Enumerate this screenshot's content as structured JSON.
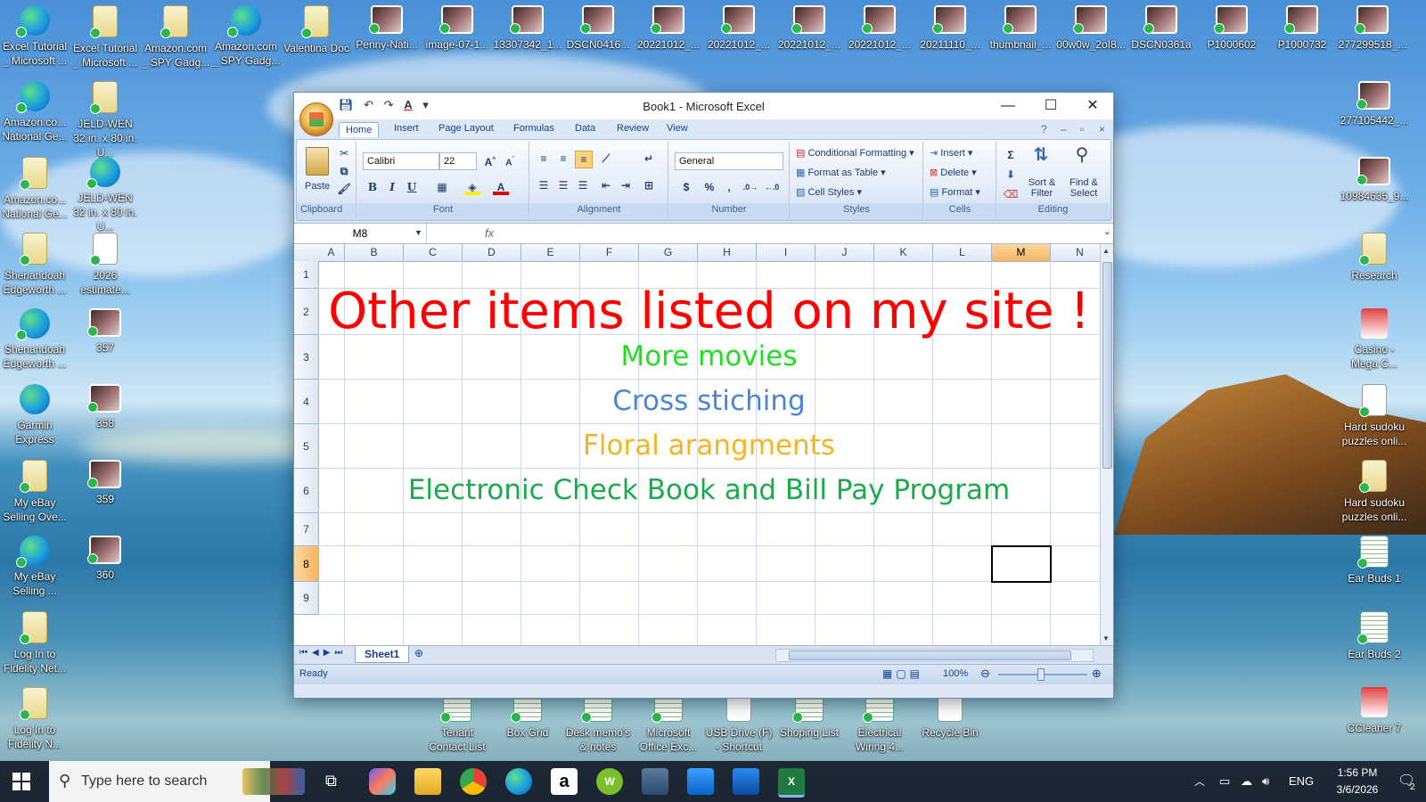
{
  "desktop": {
    "top_row": [
      {
        "label": "Excel Tutorial _ Microsoft ...",
        "icon": "edge-icon"
      },
      {
        "label": "Excel Tutorial _ Microsoft ...",
        "icon": "file-icon"
      },
      {
        "label": "Amazon.com _ SPY Gadg...",
        "icon": "file-icon"
      },
      {
        "label": "Amazon.com _ SPY Gadg...",
        "icon": "edge-icon"
      },
      {
        "label": "Valentina Doc",
        "icon": "file-icon"
      },
      {
        "label": "Penny-Nati...",
        "icon": "photo-icon"
      },
      {
        "label": "image-07-1...",
        "icon": "photo-icon"
      },
      {
        "label": "13307342_1...",
        "icon": "photo-icon"
      },
      {
        "label": "DSCN0416...",
        "icon": "photo-icon"
      },
      {
        "label": "20221012_...",
        "icon": "photo-icon"
      },
      {
        "label": "20221012_...",
        "icon": "photo-icon"
      },
      {
        "label": "20221012_...",
        "icon": "photo-icon"
      },
      {
        "label": "20221012_...",
        "icon": "photo-icon"
      },
      {
        "label": "20211110_...",
        "icon": "photo-icon"
      },
      {
        "label": "thumbnail_...",
        "icon": "photo-icon"
      },
      {
        "label": "00w0w_2oI8...",
        "icon": "photo-icon"
      },
      {
        "label": "DSCN0361a",
        "icon": "photo-icon"
      },
      {
        "label": "P1000602",
        "icon": "photo-icon"
      },
      {
        "label": "P1000732",
        "icon": "photo-icon"
      },
      {
        "label": "277299518_...",
        "icon": "photo-icon"
      }
    ],
    "left_col1": [
      {
        "label": "Amazon.co... National Ge...",
        "icon": "edge-icon"
      },
      {
        "label": "Amazon.co... National Ge...",
        "icon": "file-icon"
      },
      {
        "label": "Shenandoah Edgeworth ...",
        "icon": "file-icon"
      },
      {
        "label": "Shenandoah Edgeworth ...",
        "icon": "edge-icon"
      },
      {
        "label": "Garmin Express",
        "icon": "garmin-icon"
      },
      {
        "label": "My eBay Selling Ove...",
        "icon": "file-icon"
      },
      {
        "label": "My eBay Selling ...",
        "icon": "edge-icon"
      },
      {
        "label": "Log In to Fidelity Net...",
        "icon": "file-icon"
      },
      {
        "label": "Log In to Fidelity N...",
        "icon": "file-icon"
      }
    ],
    "left_col2": [
      {
        "label": "JELD-WEN 32 in. x 80 in. U...",
        "icon": "file-icon"
      },
      {
        "label": "JELD-WEN 32 in. x 80 in. U...",
        "icon": "edge-icon"
      },
      {
        "label": "2026 estimate...",
        "icon": "doc-icon"
      },
      {
        "label": "357",
        "icon": "photo-icon"
      },
      {
        "label": "358",
        "icon": "photo-icon"
      },
      {
        "label": "359",
        "icon": "photo-icon"
      },
      {
        "label": "360",
        "icon": "photo-icon"
      }
    ],
    "right_col": [
      {
        "label": "277105442_...",
        "icon": "photo-icon"
      },
      {
        "label": "10984635_9...",
        "icon": "photo-icon"
      },
      {
        "label": "Research",
        "icon": "file-icon"
      },
      {
        "label": "Casino - Mega C...",
        "icon": "casino-icon"
      },
      {
        "label": "Hard sudoku puzzles onli...",
        "icon": "doc-icon"
      },
      {
        "label": "Hard sudoku puzzles onli...",
        "icon": "file-icon"
      },
      {
        "label": "Ear Buds 1",
        "icon": "sheet-icon"
      },
      {
        "label": "Ear Buds 2",
        "icon": "sheet-icon"
      },
      {
        "label": "CCleaner 7",
        "icon": "ccleaner-icon"
      }
    ],
    "bottom_row": [
      {
        "label": "Tenant Contact List",
        "icon": "sheet-icon"
      },
      {
        "label": "Box Grid",
        "icon": "sheet-icon"
      },
      {
        "label": "Desk memo's & notes",
        "icon": "sheet-icon"
      },
      {
        "label": "Microsoft Office Exc...",
        "icon": "excel-icon"
      },
      {
        "label": "USB Drive (F) - Shortcut",
        "icon": "usb-icon"
      },
      {
        "label": "Shoping List",
        "icon": "sheet-icon"
      },
      {
        "label": "Electrical Wiring 4...",
        "icon": "sheet-icon"
      },
      {
        "label": "Recycle Bin",
        "icon": "recycle-bin-icon"
      }
    ]
  },
  "excel": {
    "title": "Book1 - Microsoft Excel",
    "tabs": [
      "Home",
      "Insert",
      "Page Layout",
      "Formulas",
      "Data",
      "Review",
      "View"
    ],
    "active_tab": "Home",
    "ribbon": {
      "clipboard": {
        "label": "Clipboard",
        "paste": "Paste"
      },
      "font": {
        "label": "Font",
        "name": "Calibri",
        "size": "22",
        "bold": "B",
        "italic": "I",
        "underline": "U"
      },
      "alignment": {
        "label": "Alignment"
      },
      "number": {
        "label": "Number",
        "format": "General",
        "currency": "$",
        "percent": "%",
        "comma": ","
      },
      "styles": {
        "label": "Styles",
        "conditional": "Conditional Formatting",
        "format_table": "Format as Table",
        "cell_styles": "Cell Styles"
      },
      "cells": {
        "label": "Cells",
        "insert": "Insert",
        "delete": "Delete",
        "format": "Format"
      },
      "editing": {
        "label": "Editing",
        "sort": "Sort & Filter",
        "find": "Find & Select",
        "sigma": "Σ"
      }
    },
    "name_box": "M8",
    "fx": "fx",
    "columns": [
      "A",
      "B",
      "C",
      "D",
      "E",
      "F",
      "G",
      "H",
      "I",
      "J",
      "K",
      "L",
      "M",
      "N"
    ],
    "rows": [
      "1",
      "2",
      "3",
      "4",
      "5",
      "6",
      "7",
      "8",
      "9"
    ],
    "selected_column": "M",
    "selected_row": "8",
    "cells": {
      "row2": {
        "text": "Other items listed on my site !",
        "color": "#ff0000"
      },
      "row3": {
        "text": "More movies",
        "color": "#22dd22"
      },
      "row4": {
        "text": "Cross stiching",
        "color": "#4a86d4"
      },
      "row5": {
        "text": "Floral arangments",
        "color": "#f5b423"
      },
      "row6": {
        "text": "Electronic Check Book and Bill Pay Program",
        "color": "#1aab4a"
      }
    },
    "sheet_tab": "Sheet1",
    "status": "Ready",
    "zoom": "100%"
  },
  "taskbar": {
    "search_placeholder": "Type here to search",
    "language": "ENG",
    "time": "1:56 PM",
    "date": "3/6/2026",
    "notification_count": "2"
  }
}
